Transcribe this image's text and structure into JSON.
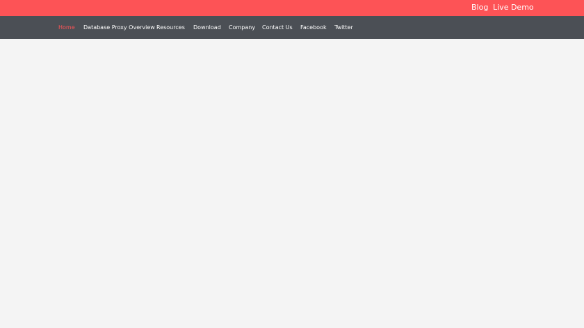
{
  "topbar": {
    "color": "#fd5356",
    "links": [
      {
        "label": "Blog"
      },
      {
        "label": "Live Demo"
      }
    ]
  },
  "nav": {
    "background": "#4b4f55",
    "items": [
      {
        "label": "Home",
        "active": true
      },
      {
        "label": "Database Proxy Overview"
      },
      {
        "label": "Resources"
      },
      {
        "label": "Download"
      },
      {
        "label": "Company"
      },
      {
        "label": "Contact Us"
      },
      {
        "label": "Facebook"
      },
      {
        "label": "Twitter"
      }
    ]
  },
  "page": {
    "background": "#f4f4f4"
  }
}
